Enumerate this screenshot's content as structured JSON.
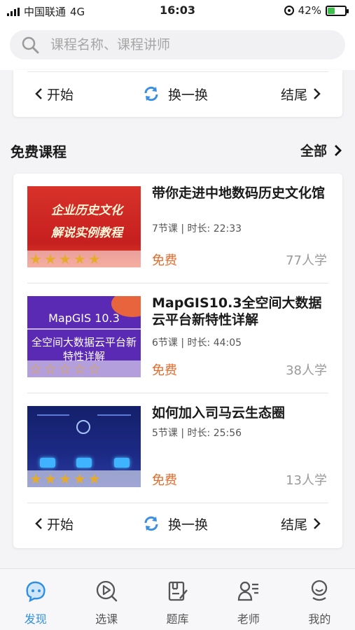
{
  "status_bar": {
    "carrier": "中国联通",
    "network": "4G",
    "time": "16:03",
    "battery": "42%",
    "battery_level": 0.42
  },
  "search": {
    "placeholder": "课程名称、课程讲师"
  },
  "pager_top": {
    "prev": "开始",
    "swap": "换一换",
    "next": "结尾"
  },
  "section": {
    "title": "免费课程",
    "more": "全部"
  },
  "courses": [
    {
      "title": "带你走进中地数码历史文化馆",
      "lessons": "7节课",
      "duration": "时长: 22:33",
      "price": "免费",
      "learners": "77人学",
      "rating": 5,
      "thumb": {
        "line1": "企业历史文化",
        "line2": "解说实例教程"
      }
    },
    {
      "title": "MapGIS10.3全空间大数据云平台新特性详解",
      "lessons": "6节课",
      "duration": "时长: 44:05",
      "price": "免费",
      "learners": "38人学",
      "rating": 0,
      "thumb": {
        "line1": "MapGIS 10.3",
        "line2": "全空间大数据云平台新特性详解"
      }
    },
    {
      "title": "如何加入司马云生态圈",
      "lessons": "5节课",
      "duration": "时长: 25:56",
      "price": "免费",
      "learners": "13人学",
      "rating": 5
    }
  ],
  "pager_bottom": {
    "prev": "开始",
    "swap": "换一换",
    "next": "结尾"
  },
  "tabbar": [
    {
      "label": "发现",
      "icon": "discover-icon",
      "active": true
    },
    {
      "label": "选课",
      "icon": "play-circle-icon",
      "active": false
    },
    {
      "label": "题库",
      "icon": "question-bank-icon",
      "active": false
    },
    {
      "label": "老师",
      "icon": "teacher-icon",
      "active": false
    },
    {
      "label": "我的",
      "icon": "profile-icon",
      "active": false
    }
  ],
  "colors": {
    "accent": "#2f8fe0",
    "price": "#e46a2c",
    "star": "#e7ab2c"
  }
}
